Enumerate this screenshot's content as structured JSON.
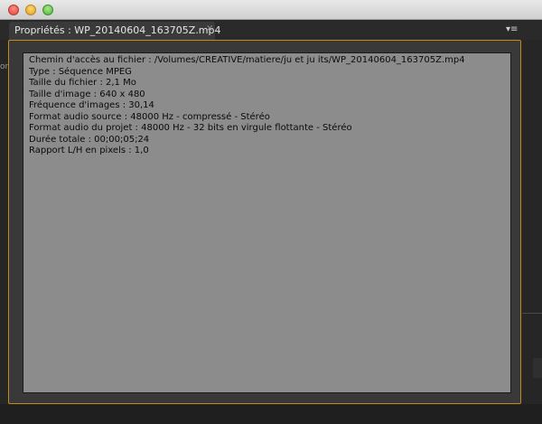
{
  "window": {
    "buttons": [
      "close",
      "minimize",
      "zoom"
    ]
  },
  "tab": {
    "label": "Propriétés : WP_20140604_163705Z.mp4",
    "close_glyph": "×"
  },
  "panel_menu_glyph": "▾≡",
  "side_letters": "or",
  "properties": [
    "Chemin d'accès au fichier : /Volumes/CREATIVE/matiere/ju et ju its/WP_20140604_163705Z.mp4",
    "Type : Séquence MPEG",
    "Taille du fichier : 2,1 Mo",
    "Taille d'image : 640 x 480",
    "Fréquence d'images : 30,14",
    "Format audio source : 48000 Hz - compressé - Stéréo",
    "Format audio du projet : 48000 Hz - 32 bits en virgule flottante - Stéréo",
    "Durée totale : 00;00;05;24",
    "Rapport L/H en pixels : 1,0"
  ],
  "colors": {
    "panel_border_accent": "#c08b1c",
    "content_background": "#8c8c8c"
  }
}
